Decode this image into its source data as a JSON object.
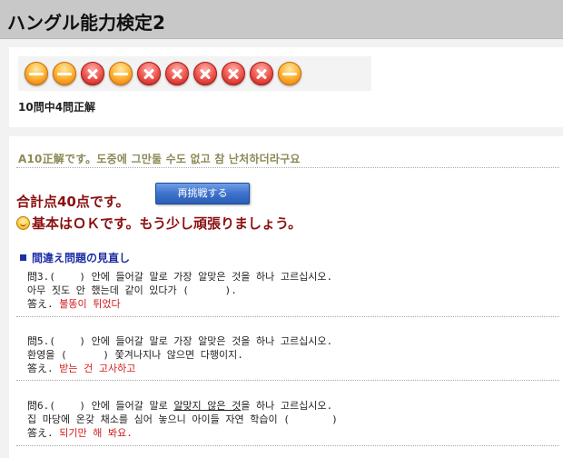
{
  "header": {
    "title": "ハングル能力検定2"
  },
  "result": {
    "icons": [
      "ok-icon",
      "ok-icon",
      "ng-icon",
      "ok-icon",
      "ng-icon",
      "ng-icon",
      "ng-icon",
      "ng-icon",
      "ng-icon",
      "ok-icon"
    ],
    "score_text": "10問中4問正解"
  },
  "feedback": {
    "answer_result": "A10正解です。도중에 그만둘 수도 없고 참 난처하더라구요",
    "total_text": "合計点40点です。",
    "retry_label": "再挑戦する",
    "comment": "基本はＯＫです。もう少し頑張りましょう。",
    "review_heading": "間違え問題の見直し"
  },
  "review": [
    {
      "q_line": "問3.(    ) 안에 들어갈 말로 가장 알맞은 것을 하나 고르십시오.",
      "sentence": "아무 짓도 안 했는데 같이 있다가 (      ).",
      "answer_label": "答え. ",
      "answer": "불똥이 튀었다"
    },
    {
      "q_line": "問5.(    ) 안에 들어갈 말로 가장 알맞은 것을 하나 고르십시오.",
      "sentence": "환영을 (      ) 쫓겨나지나 않으면 다행이지.",
      "answer_label": "答え. ",
      "answer": "받는 건 고사하고"
    },
    {
      "q_line_pre": "問6.(    ) 안에 들어갈 말로 ",
      "q_line_underlined": "알맞지 않은 것",
      "q_line_post": "을 하나 고르십시오.",
      "sentence": "집 마당에 온갖 채소를 심어 놓으니 아이들 자연 학습이 (       )",
      "answer_label": "答え. ",
      "answer": "되기만 해 봐요."
    }
  ]
}
